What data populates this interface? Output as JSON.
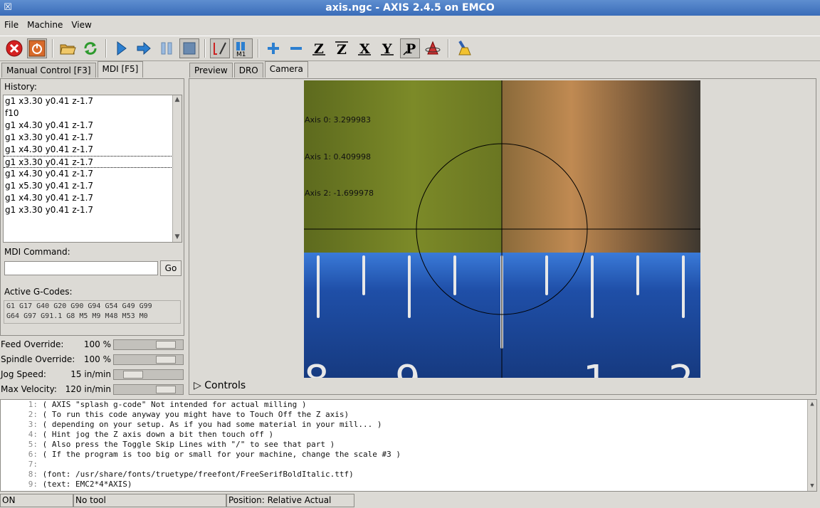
{
  "window": {
    "title": "axis.ngc - AXIS 2.4.5 on EMCO"
  },
  "menu": {
    "file": "File",
    "machine": "Machine",
    "view": "View"
  },
  "toolbar": {
    "items": [
      "estop-icon",
      "power-icon",
      "open-icon",
      "reload-icon",
      "run-icon",
      "step-icon",
      "pause-icon",
      "stop-icon",
      "skip-lines-icon",
      "optional-stop-icon",
      "zoom-in-icon",
      "zoom-out-icon",
      "view-z-icon",
      "view-z2-icon",
      "view-x-icon",
      "view-y-icon",
      "view-p-icon",
      "rotate-icon",
      "clear-plot-icon"
    ],
    "view_z": "Z",
    "view_z2": "Z",
    "view_x": "X",
    "view_y": "Y",
    "view_p": "P",
    "m1": "M1"
  },
  "left_tabs": [
    {
      "label": "Manual Control [F3]"
    },
    {
      "label": "MDI [F5]"
    }
  ],
  "mdi": {
    "history_label": "History:",
    "history": [
      "g1 x3.30 y0.41 z-1.7",
      "f10",
      "g1 x4.30 y0.41 z-1.7",
      "g1 x3.30 y0.41 z-1.7",
      "g1 x4.30 y0.41 z-1.7",
      "g1 x3.30 y0.41 z-1.7",
      "g1 x4.30 y0.41 z-1.7",
      "g1 x5.30 y0.41 z-1.7",
      "g1 x4.30 y0.41 z-1.7",
      "g1 x3.30 y0.41 z-1.7"
    ],
    "selected_index": 5,
    "command_label": "MDI Command:",
    "command_value": "",
    "go_label": "Go",
    "active_label": "Active G-Codes:",
    "active_codes_line1": "G1 G17 G40 G20 G90 G94 G54 G49 G99",
    "active_codes_line2": "G64 G97 G91.1 G8 M5 M9 M48 M53 M0"
  },
  "overrides": [
    {
      "name": "Feed Override:",
      "value": "100 %",
      "fraction": 0.75
    },
    {
      "name": "Spindle Override:",
      "value": "100 %",
      "fraction": 0.75
    },
    {
      "name": "Jog Speed:",
      "value": "15 in/min",
      "fraction": 0.28
    },
    {
      "name": "Max Velocity:",
      "value": "120 in/min",
      "fraction": 0.75
    }
  ],
  "right_tabs": [
    {
      "label": "Preview"
    },
    {
      "label": "DRO"
    },
    {
      "label": "Camera"
    }
  ],
  "camera": {
    "axis0": "Axis 0: 3.299983",
    "axis1": "Axis 1: 0.409998",
    "axis2": "Axis 2: -1.699978",
    "ruler_numbers": [
      "8",
      "9",
      "1",
      "2"
    ]
  },
  "controls_label": "Controls",
  "gcode_lines": [
    {
      "n": "1:",
      "t": "( AXIS \"splash g-code\" Not intended for actual milling )"
    },
    {
      "n": "2:",
      "t": "( To run this code anyway you might have to Touch Off the Z axis)"
    },
    {
      "n": "3:",
      "t": "( depending on your setup. As if you had some material in your mill... )"
    },
    {
      "n": "4:",
      "t": "( Hint jog the Z axis down a bit then touch off )"
    },
    {
      "n": "5:",
      "t": "( Also press the Toggle Skip Lines with \"/\" to see that part )"
    },
    {
      "n": "6:",
      "t": "( If the program is too big or small for your machine, change the scale #3 )"
    },
    {
      "n": "7:",
      "t": ""
    },
    {
      "n": "8:",
      "t": "(font: /usr/share/fonts/truetype/freefont/FreeSerifBoldItalic.ttf)"
    },
    {
      "n": "9:",
      "t": "(text: EMC2*4*AXIS)"
    }
  ],
  "status": {
    "state": "ON",
    "tool": "No tool",
    "position": "Position: Relative Actual"
  },
  "colors": {
    "titlebar": "#3a6cb8",
    "estop_red": "#d42020",
    "power_orange": "#d86a2a",
    "run_blue": "#2c7fd0",
    "ruler_blue": "#1f4fa8"
  }
}
